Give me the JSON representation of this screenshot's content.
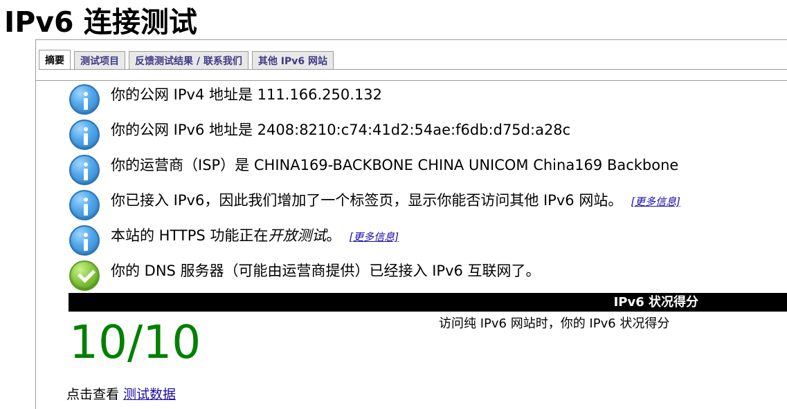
{
  "title": "IPv6 连接测试",
  "tabs": [
    {
      "label": "摘要",
      "active": true
    },
    {
      "label": "测试项目",
      "active": false
    },
    {
      "label": "反馈测试结果 / 联系我们",
      "active": false
    },
    {
      "label": "其他 IPv6 网站",
      "active": false
    }
  ],
  "info": [
    {
      "icon": "info-icon",
      "text": "你的公网 IPv4 地址是 111.166.250.132"
    },
    {
      "icon": "info-icon",
      "text": "你的公网 IPv6 地址是 2408:8210:c74:41d2:54ae:f6db:d75d:a28c"
    },
    {
      "icon": "info-icon",
      "text": "你的运营商（ISP）是 CHINA169-BACKBONE CHINA UNICOM China169 Backbone"
    },
    {
      "icon": "info-icon",
      "text": "你已接入 IPv6，因此我们增加了一个标签页，显示你能否访问其他 IPv6 网站。",
      "link": "[更多信息]"
    },
    {
      "icon": "info-icon",
      "text_prefix": "本站的 HTTPS 功能正在",
      "text_emphasis": "开放测试",
      "text_suffix": "。",
      "link": "[更多信息]"
    },
    {
      "icon": "check-icon",
      "text": "你的 DNS 服务器（可能由运营商提供）已经接入 IPv6 互联网了。"
    }
  ],
  "score": {
    "heading": "IPv6 状况得分",
    "value": "10/10",
    "description": "访问纯 IPv6 网站时，你的 IPv6 状况得分",
    "color": "#008000"
  },
  "footer": {
    "prefix": "点击查看",
    "link": "测试数据"
  },
  "colors": {
    "link": "#1a0dab",
    "tab_text": "#3d3a87",
    "score_bar": "#000000"
  }
}
